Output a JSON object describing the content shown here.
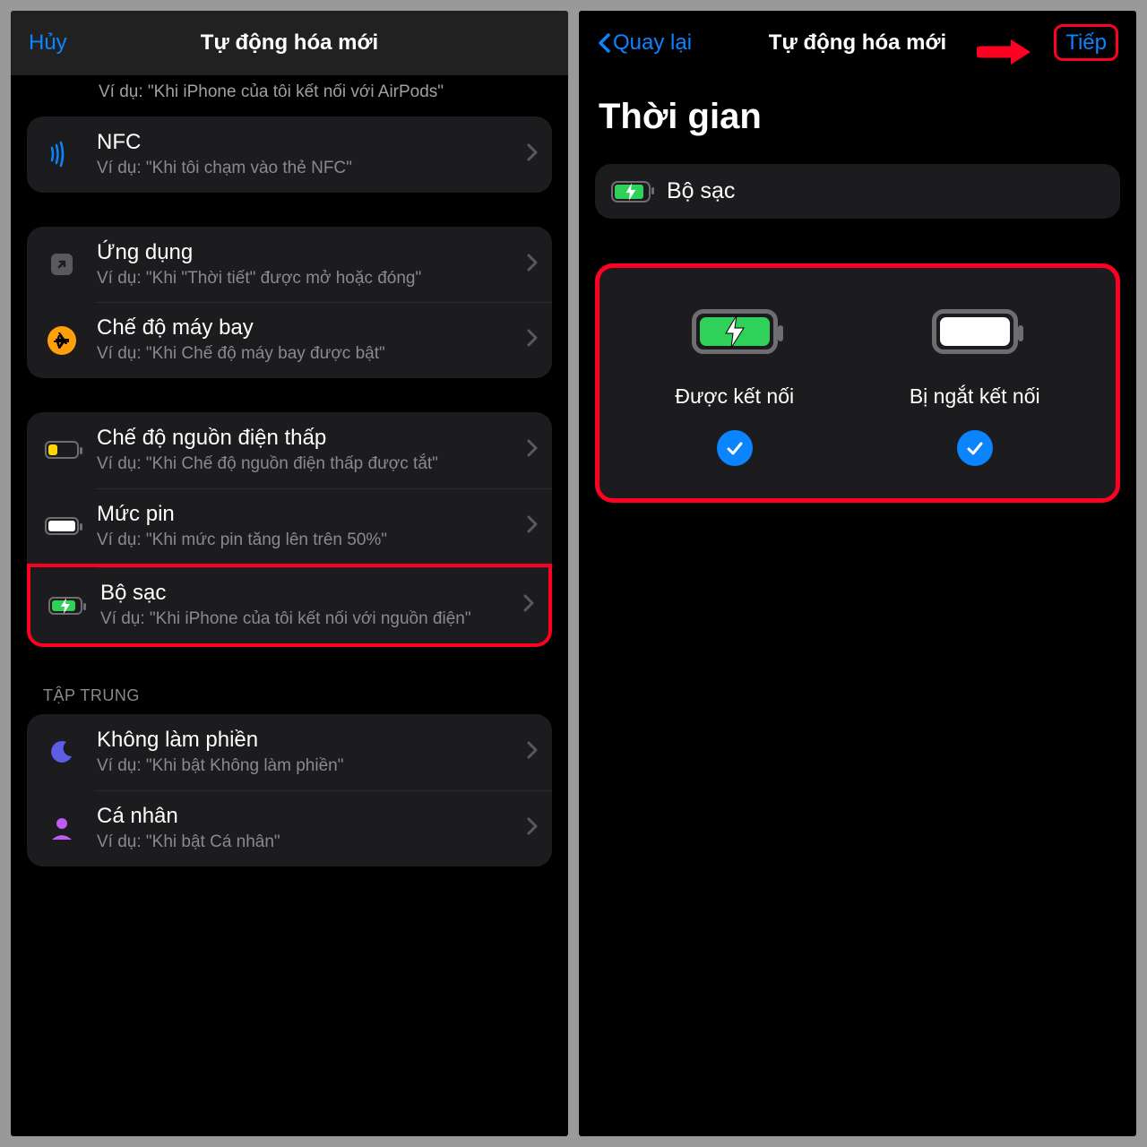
{
  "left": {
    "header": {
      "cancel": "Hủy",
      "title": "Tự động hóa mới"
    },
    "float_subtitle": "Ví dụ: \"Khi iPhone của tôi kết nối với AirPods\"",
    "rows": {
      "nfc": {
        "title": "NFC",
        "sub": "Ví dụ: \"Khi tôi chạm vào thẻ NFC\""
      },
      "app": {
        "title": "Ứng dụng",
        "sub": "Ví dụ: \"Khi \"Thời tiết\" được mở hoặc đóng\""
      },
      "airplane": {
        "title": "Chế độ máy bay",
        "sub": "Ví dụ: \"Khi Chế độ máy bay được bật\""
      },
      "lowpower": {
        "title": "Chế độ nguồn điện thấp",
        "sub": "Ví dụ: \"Khi Chế độ nguồn điện thấp được tắt\""
      },
      "battlevel": {
        "title": "Mức pin",
        "sub": "Ví dụ: \"Khi mức pin tăng lên trên 50%\""
      },
      "charger": {
        "title": "Bộ sạc",
        "sub": "Ví dụ: \"Khi iPhone của tôi kết nối với nguồn điện\""
      },
      "dnd": {
        "title": "Không làm phiền",
        "sub": "Ví dụ: \"Khi bật Không làm phiền\""
      },
      "personal": {
        "title": "Cá nhân",
        "sub": "Ví dụ: \"Khi bật Cá nhân\""
      }
    },
    "section_focus": "TẬP TRUNG"
  },
  "right": {
    "header": {
      "back": "Quay lại",
      "title": "Tự động hóa mới",
      "next": "Tiếp"
    },
    "time_title": "Thời gian",
    "charger_label": "Bộ sạc",
    "options": {
      "connected": "Được kết nối",
      "disconnected": "Bị ngắt kết nối"
    }
  }
}
